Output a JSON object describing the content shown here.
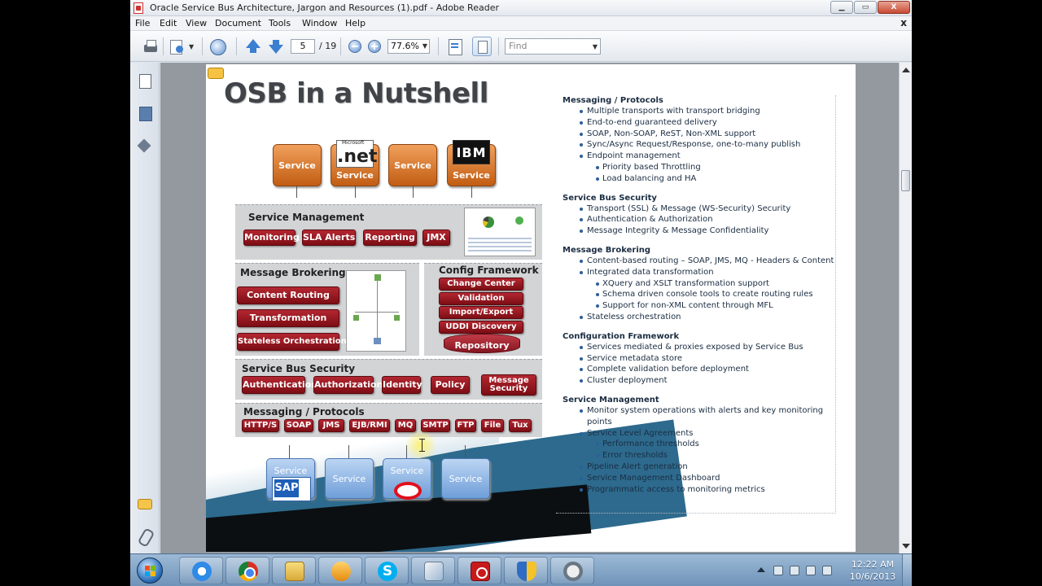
{
  "window": {
    "title": "Oracle Service Bus Architecture, Jargon and Resources (1).pdf - Adobe Reader",
    "controls": {
      "minimize": "▁",
      "maximize": "▭",
      "close": "X"
    },
    "doc_close": "x"
  },
  "menu": {
    "items": [
      "File",
      "Edit",
      "View",
      "Document",
      "Tools",
      "Window",
      "Help"
    ]
  },
  "toolbar": {
    "page_current": "5",
    "page_total": "/ 19",
    "zoom": "77.6%",
    "find_placeholder": "Find"
  },
  "slide": {
    "title": "OSB in a Nutshell",
    "top_services": [
      {
        "label": "Service",
        "logo": ""
      },
      {
        "label": "Service",
        "logo": ".net"
      },
      {
        "label": "Service",
        "logo": ""
      },
      {
        "label": "Service",
        "logo": "IBM"
      }
    ],
    "service_management": {
      "title": "Service Management",
      "chips": [
        "Monitoring",
        "SLA Alerts",
        "Reporting",
        "JMX"
      ]
    },
    "message_brokering": {
      "title": "Message Brokering",
      "chips": [
        "Content Routing",
        "Transformation",
        "Stateless Orchestration"
      ]
    },
    "config_framework": {
      "title": "Config Framework",
      "chips": [
        "Change Center",
        "Validation",
        "Import/Export",
        "UDDI Discovery"
      ],
      "repository": "Repository"
    },
    "service_bus_security": {
      "title": "Service Bus Security",
      "chips": [
        "Authentication",
        "Authorization",
        "Identity",
        "Policy",
        "Message Security"
      ]
    },
    "messaging_protocols": {
      "title": "Messaging / Protocols",
      "chips": [
        "HTTP/S",
        "SOAP",
        "JMS",
        "EJB/RMI",
        "MQ",
        "SMTP",
        "FTP",
        "File",
        "Tux"
      ]
    },
    "bottom_services": [
      {
        "label": "Service",
        "logo": "SAP"
      },
      {
        "label": "Service",
        "logo": ""
      },
      {
        "label": "Service",
        "logo": "oracle"
      },
      {
        "label": "Service",
        "logo": ""
      }
    ]
  },
  "notes": [
    {
      "heading": "Messaging / Protocols",
      "items": [
        {
          "text": "Multiple transports with transport bridging",
          "level": 1
        },
        {
          "text": "End-to-end guaranteed delivery",
          "level": 1
        },
        {
          "text": "SOAP, Non-SOAP, ReST, Non-XML support",
          "level": 1
        },
        {
          "text": "Sync/Async Request/Response, one-to-many publish",
          "level": 1
        },
        {
          "text": "Endpoint management",
          "level": 1
        },
        {
          "text": "Priority based Throttling",
          "level": 2
        },
        {
          "text": "Load balancing and HA",
          "level": 2
        }
      ]
    },
    {
      "heading": "Service Bus Security",
      "items": [
        {
          "text": "Transport (SSL) & Message (WS-Security) Security",
          "level": 1
        },
        {
          "text": "Authentication & Authorization",
          "level": 1
        },
        {
          "text": "Message Integrity & Message Confidentiality",
          "level": 1
        }
      ]
    },
    {
      "heading": "Message Brokering",
      "items": [
        {
          "text": "Content-based routing – SOAP, JMS, MQ - Headers & Content",
          "level": 1
        },
        {
          "text": "Integrated data transformation",
          "level": 1
        },
        {
          "text": "XQuery and XSLT transformation support",
          "level": 2
        },
        {
          "text": "Schema driven console tools to create routing rules",
          "level": 2
        },
        {
          "text": "Support for non-XML content through MFL",
          "level": 2
        },
        {
          "text": "Stateless orchestration",
          "level": 1
        }
      ]
    },
    {
      "heading": "Configuration Framework",
      "items": [
        {
          "text": "Services mediated & proxies exposed by Service Bus",
          "level": 1
        },
        {
          "text": "Service metadata store",
          "level": 1
        },
        {
          "text": "Complete validation before deployment",
          "level": 1
        },
        {
          "text": "Cluster deployment",
          "level": 1
        }
      ]
    },
    {
      "heading": "Service Management",
      "items": [
        {
          "text": "Monitor system operations with alerts and key monitoring points",
          "level": 1
        },
        {
          "text": "Service Level Agreements",
          "level": 1
        },
        {
          "text": "Performance thresholds",
          "level": 2
        },
        {
          "text": "Error thresholds",
          "level": 2
        },
        {
          "text": "Pipeline Alert generation",
          "level": 1
        },
        {
          "text": "Service Management Dashboard",
          "level": 1
        },
        {
          "text": "Programmatic access to monitoring metrics",
          "level": 1
        }
      ]
    }
  ],
  "taskbar": {
    "apps": [
      "internet-explorer",
      "chrome",
      "windows-explorer",
      "media-player",
      "skype",
      "paint",
      "adobe-reader",
      "security-center",
      "performance-monitor"
    ],
    "skype_glyph": "S",
    "clock_time": "12:22 AM",
    "clock_date": "10/6/2013"
  }
}
